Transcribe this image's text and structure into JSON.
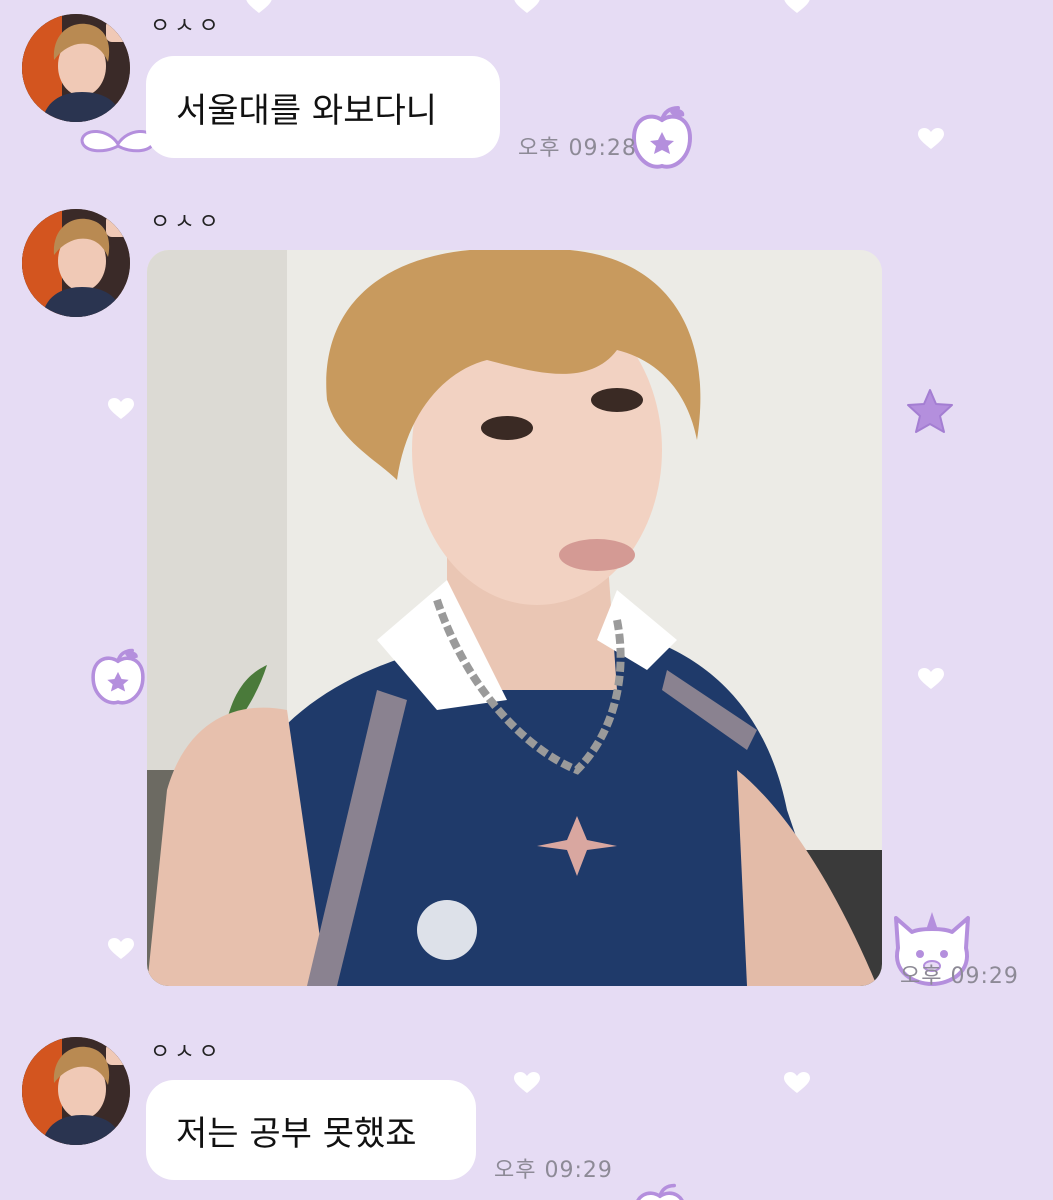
{
  "theme": {
    "background": "#e6dcf4",
    "bubble": "#ffffff",
    "time_color": "#8d8a96",
    "decor_color": "#b48fdd"
  },
  "messages": [
    {
      "sender": "ㅇㅅㅇ",
      "text": "서울대를 와보다니",
      "time": "오후 09:28"
    },
    {
      "sender": "ㅇㅅㅇ",
      "type": "photo",
      "photo_icon": "selfie-photo",
      "time": "오후 09:29"
    },
    {
      "sender": "ㅇㅅㅇ",
      "text": "저는 공부 못했죠",
      "time": "오후 09:29"
    }
  ],
  "icons": {
    "avatar": "profile-avatar",
    "background_decor": [
      "heart-icon",
      "star-icon",
      "apple-icon",
      "cat-icon",
      "wings-icon"
    ]
  }
}
